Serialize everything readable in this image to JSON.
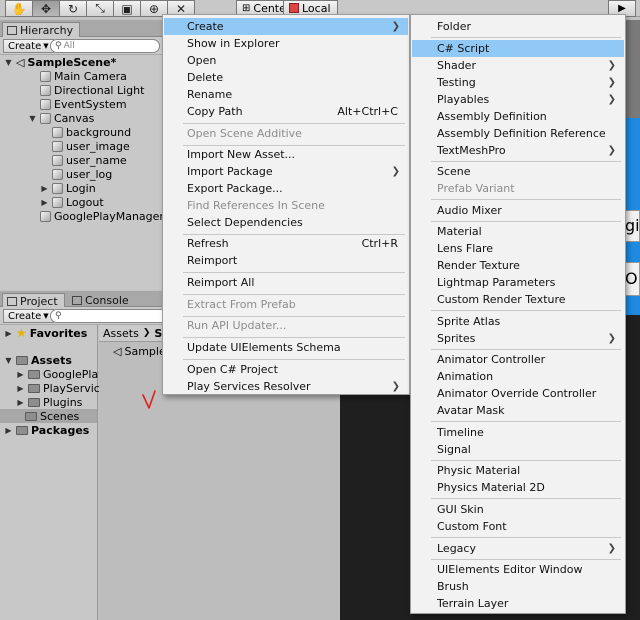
{
  "toolbar": {
    "tools": [
      {
        "icon": "hand-icon",
        "glyph": "✋"
      },
      {
        "icon": "move-icon",
        "glyph": "✥"
      },
      {
        "icon": "rotate-icon",
        "glyph": "↻"
      },
      {
        "icon": "scale-icon",
        "glyph": "⤡"
      },
      {
        "icon": "rect-tool-icon",
        "glyph": "▣"
      },
      {
        "icon": "transform-tool-icon",
        "glyph": "⊕"
      },
      {
        "icon": "custom-tool-icon",
        "glyph": "✕"
      }
    ],
    "pivot_center": "Center",
    "pivot_local": "Local",
    "play_icon": "play-icon"
  },
  "hierarchy": {
    "tab": "Hierarchy",
    "create": "Create",
    "search_placeholder": "All",
    "scene": "SampleScene*",
    "items": [
      "Main Camera",
      "Directional Light",
      "EventSystem",
      "Canvas",
      "background",
      "user_image",
      "user_name",
      "user_log",
      "Login",
      "Logout",
      "GooglePlayManager"
    ]
  },
  "project": {
    "tab_project": "Project",
    "tab_console": "Console",
    "create": "Create",
    "favorites": "Favorites",
    "assets": "Assets",
    "folders": [
      "GooglePlayG",
      "PlayServices",
      "Plugins",
      "Scenes"
    ],
    "packages": "Packages",
    "breadcrumb_root": "Assets",
    "breadcrumb_current": "S",
    "file_item": "Sample"
  },
  "game_view": {
    "box1_text": "gi",
    "box2_text": "O"
  },
  "context_menu": {
    "items": {
      "create": "Create",
      "show_in_explorer": "Show in Explorer",
      "open": "Open",
      "delete": "Delete",
      "rename": "Rename",
      "copy_path": "Copy Path",
      "copy_path_shortcut": "Alt+Ctrl+C",
      "open_scene_additive": "Open Scene Additive",
      "import_new_asset": "Import New Asset...",
      "import_package": "Import Package",
      "export_package": "Export Package...",
      "find_references": "Find References In Scene",
      "select_dependencies": "Select Dependencies",
      "refresh": "Refresh",
      "refresh_shortcut": "Ctrl+R",
      "reimport": "Reimport",
      "reimport_all": "Reimport All",
      "extract_from_prefab": "Extract From Prefab",
      "run_api_updater": "Run API Updater...",
      "update_uielements": "Update UIElements Schema",
      "open_cs_project": "Open C# Project",
      "play_services_resolver": "Play Services Resolver"
    }
  },
  "create_submenu": {
    "items": {
      "folder": "Folder",
      "cs_script": "C# Script",
      "shader": "Shader",
      "testing": "Testing",
      "playables": "Playables",
      "assembly_definition": "Assembly Definition",
      "assembly_definition_reference": "Assembly Definition Reference",
      "textmeshpro": "TextMeshPro",
      "scene": "Scene",
      "prefab_variant": "Prefab Variant",
      "audio_mixer": "Audio Mixer",
      "material": "Material",
      "lens_flare": "Lens Flare",
      "render_texture": "Render Texture",
      "lightmap_parameters": "Lightmap Parameters",
      "custom_render_texture": "Custom Render Texture",
      "sprite_atlas": "Sprite Atlas",
      "sprites": "Sprites",
      "animator_controller": "Animator Controller",
      "animation": "Animation",
      "animator_override_controller": "Animator Override Controller",
      "avatar_mask": "Avatar Mask",
      "timeline": "Timeline",
      "signal": "Signal",
      "physic_material": "Physic Material",
      "physics_material_2d": "Physics Material 2D",
      "gui_skin": "GUI Skin",
      "custom_font": "Custom Font",
      "legacy": "Legacy",
      "uielements_editor_window": "UIElements Editor Window",
      "brush": "Brush",
      "terrain_layer": "Terrain Layer"
    }
  },
  "colors": {
    "highlight": "#90c8f6",
    "accent_blue": "#1e8ae0",
    "annotation_red": "#e02020"
  }
}
